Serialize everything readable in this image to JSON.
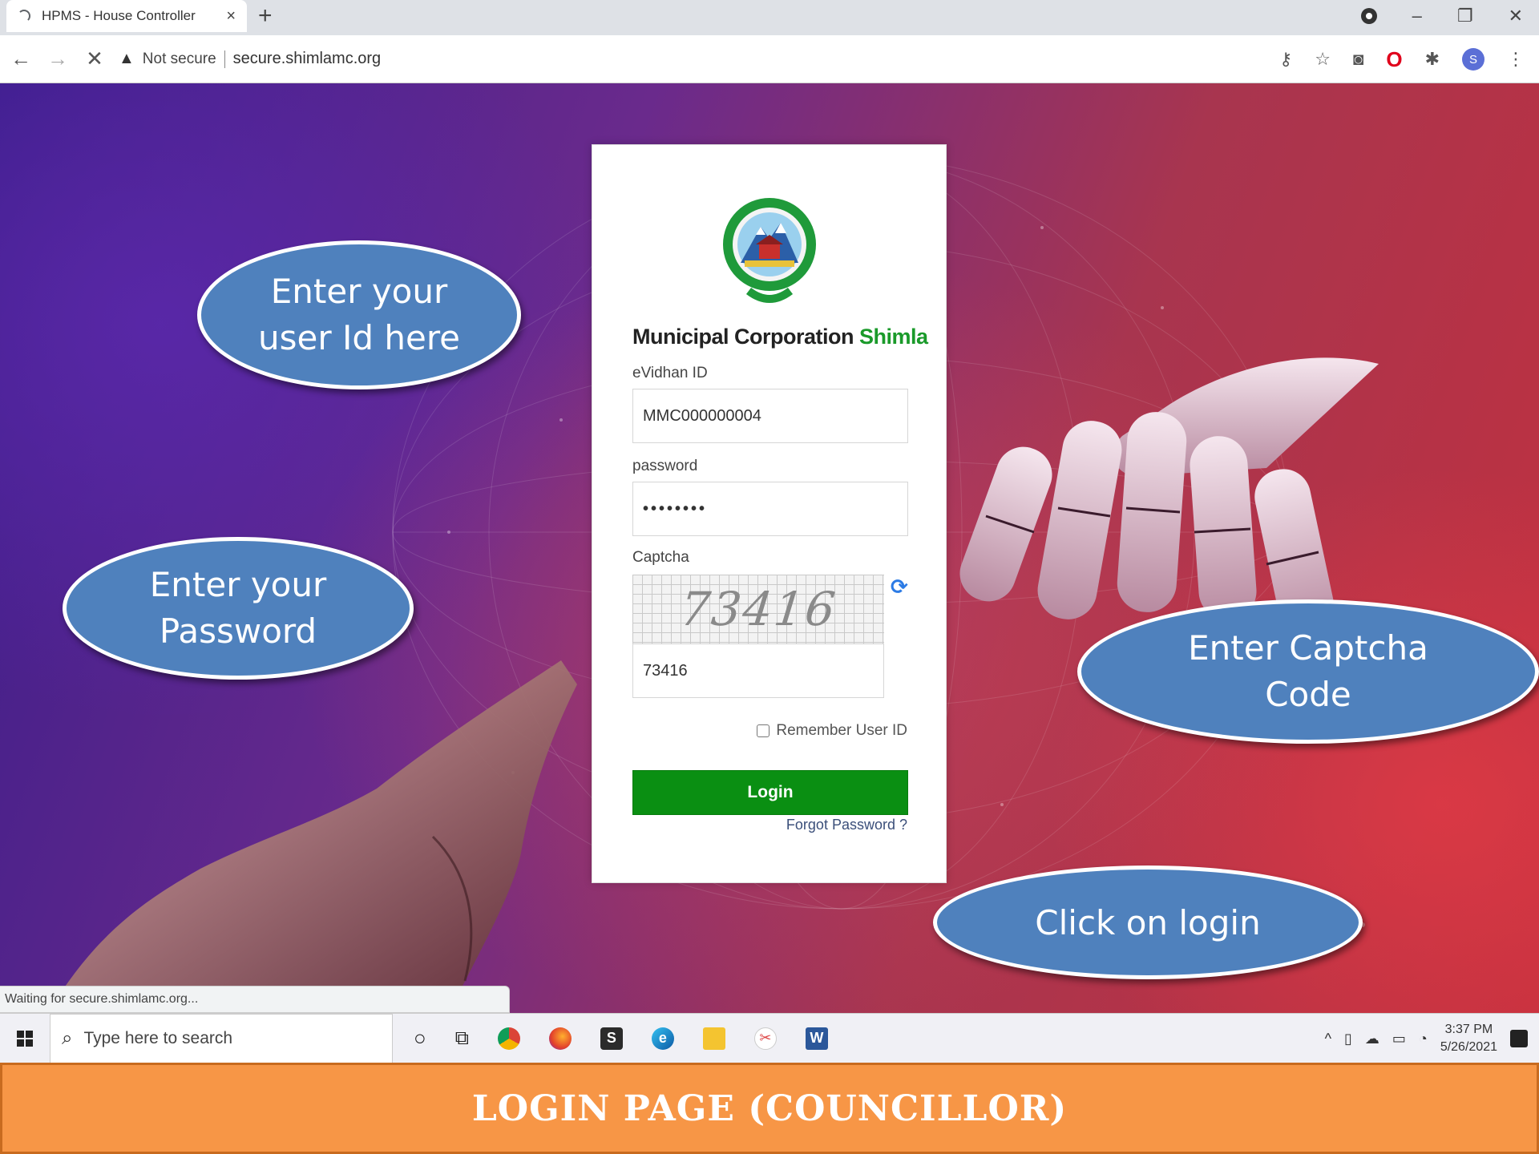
{
  "browser": {
    "tab_title": "HPMS - House Controller",
    "tab_close": "×",
    "new_tab": "+",
    "security_label": "Not secure",
    "url": "secure.shimlamc.org",
    "avatar_letter": "S",
    "status_text": "Waiting for secure.shimlamc.org..."
  },
  "login": {
    "org_name": "Municipal Corporation",
    "org_city": "Shimla",
    "id_label": "eVidhan ID",
    "id_value": "MMC000000004",
    "password_label": "password",
    "password_value": "••••••••",
    "captcha_label": "Captcha",
    "captcha_image_text": "73416",
    "captcha_value": "73416",
    "remember_label": "Remember User ID",
    "login_button": "Login",
    "forgot_link": "Forgot Password ?"
  },
  "callouts": {
    "user_id_line1": "Enter your",
    "user_id_line2": "user Id here",
    "password_line1": "Enter your",
    "password_line2": "Password",
    "captcha_line1": "Enter Captcha",
    "captcha_line2": "Code",
    "login": "Click on login"
  },
  "taskbar": {
    "search_placeholder": "Type here to search",
    "time": "3:37 PM",
    "date": "5/26/2021"
  },
  "footer": {
    "title": "Login Page (Councillor)"
  },
  "colors": {
    "login_green": "#0a8f12",
    "callout_blue": "#4f81bd",
    "footer_orange": "#f79646"
  }
}
